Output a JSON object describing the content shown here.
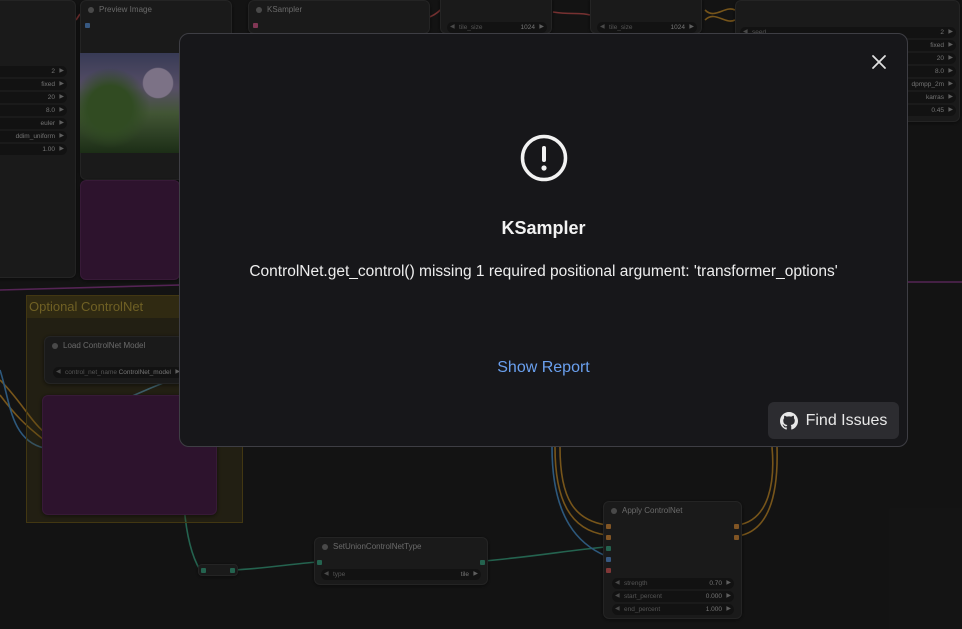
{
  "canvas": {
    "nodes": {
      "preview_image": {
        "title": "Preview Image"
      },
      "ksampler": {
        "title": "KSampler"
      },
      "load_controlnet": {
        "title": "Load ControlNet Model",
        "widget_label": "control_net_name",
        "widget_value": "ControlNet_model"
      },
      "set_union": {
        "title": "SetUnionControlNetType",
        "widget_label": "type",
        "widget_value": "tile"
      },
      "apply_controlnet": {
        "title": "Apply ControlNet",
        "widgets": [
          {
            "label": "strength",
            "value": "0.70"
          },
          {
            "label": "start_percent",
            "value": "0.000"
          },
          {
            "label": "end_percent",
            "value": "1.000"
          }
        ]
      },
      "left_sampler": {
        "widgets": [
          "2",
          "fixed",
          "20",
          "8.0",
          "euler",
          "ddim_uniform",
          "1.00"
        ]
      },
      "right_sampler": {
        "widgets": [
          {
            "label": "seed",
            "value": "2"
          },
          {
            "label": "",
            "value": "fixed"
          },
          {
            "label": "",
            "value": "20"
          },
          {
            "label": "",
            "value": "8.0"
          },
          {
            "label": "",
            "value": "dpmpp_2m"
          },
          {
            "label": "",
            "value": "karras"
          },
          {
            "label": "",
            "value": "0.45"
          }
        ]
      },
      "tile_nodes": [
        {
          "label": "tile_size",
          "value": "1024"
        },
        {
          "label": "tile_size",
          "value": "1024"
        }
      ]
    },
    "group": {
      "title": "Optional ControlNet"
    }
  },
  "dialog": {
    "title": "KSampler",
    "message": "ControlNet.get_control() missing 1 required positional argument: 'transformer_options'",
    "show_report_label": "Show Report",
    "find_issues_label": "Find Issues"
  }
}
